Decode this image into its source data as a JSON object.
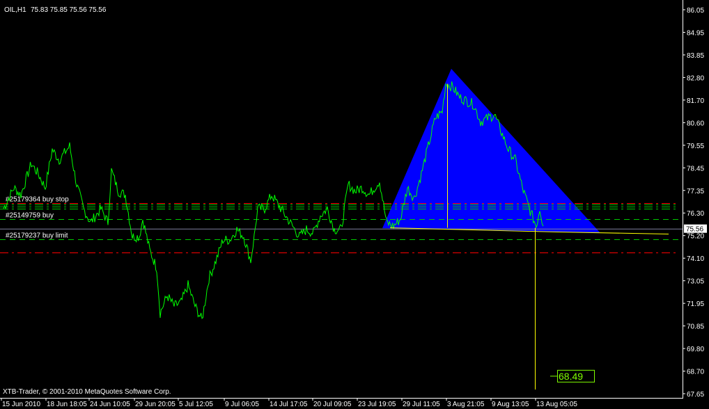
{
  "header": {
    "symbol": "OIL,H1",
    "ohlc": "75.83 75.85 75.56 75.56"
  },
  "footer": {
    "copyright": "XTB-Trader, © 2001-2010 MetaQuotes Software Corp."
  },
  "colors": {
    "background": "#000000",
    "price": "#00ff00",
    "axis": "#ffffff",
    "triangle": "#0000ff",
    "yellow": "#ffff00",
    "red": "#ff0000",
    "green": "#00c800",
    "bidline": "#8080a0",
    "label_green": "#7fff00"
  },
  "chart_data": {
    "type": "line",
    "title": "OIL,H1",
    "ylim": [
      67.65,
      86.05
    ],
    "y_ticks": [
      "86.05",
      "84.95",
      "83.85",
      "82.80",
      "81.70",
      "80.60",
      "79.55",
      "78.45",
      "77.35",
      "76.30",
      "75.20",
      "74.10",
      "73.05",
      "71.95",
      "70.85",
      "69.80",
      "68.70",
      "67.65"
    ],
    "x_tick_labels": [
      "15 Jun 2010",
      "18 Jun 18:05",
      "24 Jun 10:05",
      "29 Jun 20:05",
      "5 Jul 12:05",
      "9 Jul 06:05",
      "14 Jul 17:05",
      "20 Jul 09:05",
      "23 Jul 19:05",
      "29 Jul 11:05",
      "3 Aug 21:05",
      "9 Aug 13:05",
      "13 Aug 05:05"
    ],
    "x_tick_bars": [
      0.4,
      13.2,
      25.6,
      38.6,
      51.2,
      64.4,
      77.2,
      89.8,
      102.6,
      115.4,
      128.2,
      141,
      153.8
    ],
    "series": [
      {
        "name": "OIL close",
        "bars": [
          1,
          4,
          6,
          9,
          11,
          13,
          15,
          17,
          20,
          22,
          24,
          26,
          29,
          31,
          32,
          34,
          36,
          38,
          40,
          41,
          43,
          45,
          46,
          48,
          50,
          52,
          54,
          56,
          58,
          60,
          62,
          64,
          66,
          68,
          70,
          72,
          73,
          74,
          76,
          78,
          80,
          82,
          84,
          86,
          88,
          90,
          92,
          94,
          96,
          98,
          100,
          102,
          104,
          106,
          109,
          111,
          113,
          115,
          117,
          119,
          121,
          123,
          125,
          127,
          128,
          130,
          132,
          134,
          136,
          138,
          140,
          142,
          144,
          146,
          148,
          150,
          152,
          154,
          155,
          156
        ],
        "values": [
          76.52,
          77.52,
          77.18,
          78.68,
          78.18,
          77.52,
          79.35,
          78.85,
          79.52,
          77.68,
          76.52,
          75.85,
          76.52,
          75.85,
          78.35,
          77.35,
          77.18,
          75.18,
          75.18,
          76.02,
          74.52,
          73.68,
          71.52,
          72.35,
          71.85,
          72.02,
          72.85,
          71.85,
          71.18,
          73.18,
          74.02,
          75.02,
          75.02,
          75.52,
          75.18,
          74.02,
          75.18,
          76.52,
          76.52,
          77.18,
          76.68,
          76.18,
          75.68,
          75.18,
          75.52,
          75.35,
          76.18,
          76.52,
          75.52,
          75.52,
          77.68,
          77.35,
          77.52,
          77.18,
          77.85,
          75.85,
          75.68,
          76.02,
          77.52,
          77.02,
          78.18,
          79.52,
          80.85,
          81.18,
          82.52,
          82.35,
          81.85,
          81.68,
          81.52,
          80.68,
          80.85,
          81.02,
          80.18,
          79.35,
          78.85,
          77.52,
          76.52,
          75.68,
          76.52,
          75.68
        ]
      }
    ],
    "current_price": "75.56",
    "order_lines": [
      {
        "label": "#25179364 buy stop",
        "price": 76.78,
        "color": "#ff0000",
        "style": "dashdot"
      },
      {
        "label": "",
        "price": 76.72,
        "color": "#00c800",
        "style": "dashdot"
      },
      {
        "label": "",
        "price": 76.62,
        "color": "#00c800",
        "style": "dashdot"
      },
      {
        "label": "",
        "price": 76.52,
        "color": "#00c800",
        "style": "dashdot"
      },
      {
        "label": "#25149759 buy",
        "price": 76.0,
        "color": "#00c800",
        "style": "dash"
      },
      {
        "label": "#25179237 buy limit",
        "price": 75.05,
        "color": "#00c800",
        "style": "dash"
      },
      {
        "label": "",
        "price": 74.4,
        "color": "#ff0000",
        "style": "dashdot"
      }
    ],
    "triangle": [
      [
        109.8,
        75.58
      ],
      [
        129.6,
        83.22
      ],
      [
        172.4,
        75.35
      ]
    ],
    "yellow_vertical": [
      {
        "bar": 128.4,
        "from": 75.6,
        "to": 82.5
      },
      {
        "bar": 153.6,
        "from": 67.85,
        "to": 75.6
      }
    ],
    "yellow_trend": [
      [
        112,
        75.6
      ],
      [
        160,
        75.4
      ],
      [
        192,
        75.3
      ]
    ],
    "price_label": "68.49",
    "price_label_value": 68.49
  }
}
